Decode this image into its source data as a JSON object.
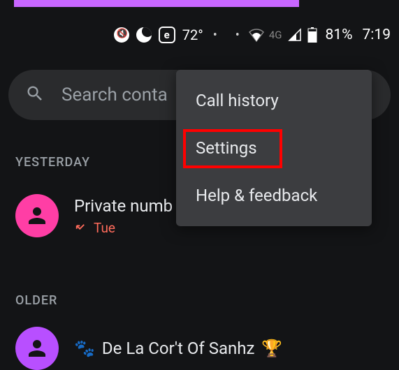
{
  "status_bar": {
    "temperature": "72°",
    "network_type": "4G",
    "battery_percent": "81%",
    "time": "7:19"
  },
  "search": {
    "placeholder": "Search conta"
  },
  "menu": {
    "items": [
      {
        "label": "Call history"
      },
      {
        "label": "Settings"
      },
      {
        "label": "Help & feedback"
      }
    ],
    "highlighted_index": 1
  },
  "sections": {
    "yesterday_label": "YESTERDAY",
    "older_label": "OLDER"
  },
  "calls": [
    {
      "name": "Private numb",
      "day": "Tue",
      "avatar_color": "pink"
    },
    {
      "name": "De La Cor't Of Sanhz",
      "prefix_emoji": "🐾",
      "suffix_emoji": "🏆",
      "avatar_color": "purple"
    }
  ]
}
